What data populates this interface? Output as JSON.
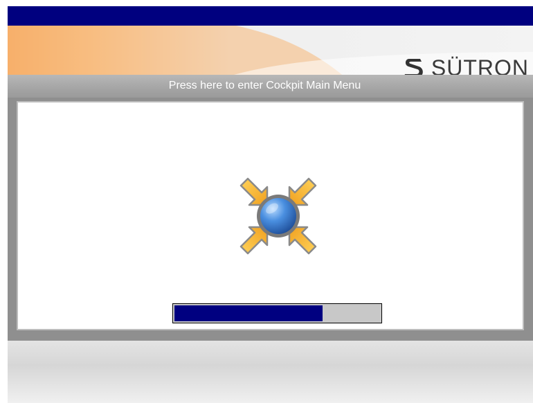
{
  "app": {
    "brand": "SÜTRON",
    "enter_menu_label": "Press here to enter Cockpit Main Menu"
  },
  "loading": {
    "icon": "fullscreen-collapse-icon",
    "progress_fraction": 0.72
  },
  "colors": {
    "top_bar": "#00007f",
    "progress_fill": "#000080",
    "progress_track": "#c8c8c8",
    "accent_orange": "#f5a55a",
    "enter_bar": "#a6a6a6"
  }
}
